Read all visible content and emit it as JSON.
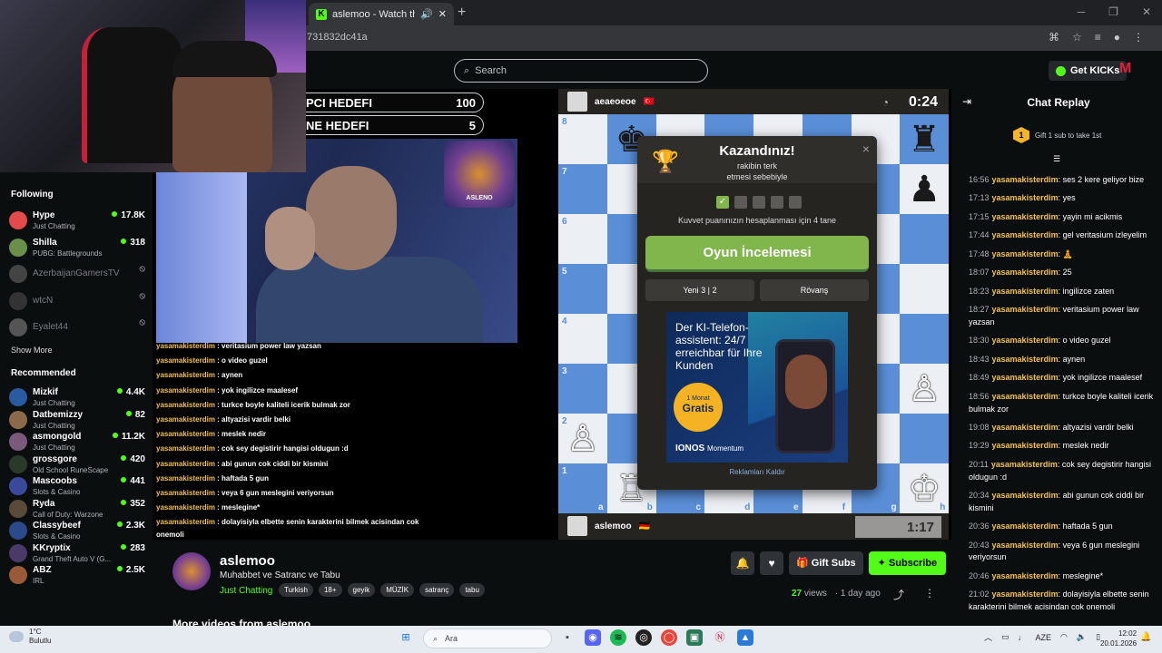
{
  "browser": {
    "tab_title": "aslemoo - Watch the VOD",
    "tab_favicon": "K",
    "new_tab": "+",
    "url_fragment": "731832dc41a"
  },
  "header": {
    "search_placeholder": "Search",
    "get_kicks": "Get KICKs"
  },
  "sidebar": {
    "following_label": "Following",
    "show_more": "Show More",
    "recommended_label": "Recommended",
    "following": [
      {
        "name": "Hype",
        "game": "Just Chatting",
        "viewers": "17.8K",
        "color": "#e34b4b"
      },
      {
        "name": "Shilla",
        "game": "PUBG: Battlegrounds",
        "viewers": "318",
        "color": "#6a8f4a"
      },
      {
        "name": "AzerbaijanGamersTV",
        "game": "",
        "viewers": "",
        "color": "#444"
      },
      {
        "name": "wtcN",
        "game": "",
        "viewers": "",
        "color": "#333"
      },
      {
        "name": "Eyalet44",
        "game": "",
        "viewers": "",
        "color": "#555"
      }
    ],
    "recommended": [
      {
        "name": "Mizkif",
        "game": "Just Chatting",
        "viewers": "4.4K",
        "color": "#2a5aa0"
      },
      {
        "name": "Datbemizzy",
        "game": "Just Chatting",
        "viewers": "82",
        "color": "#8a6a4a"
      },
      {
        "name": "asmongold",
        "game": "Just Chatting",
        "viewers": "11.2K",
        "color": "#7a5a7a"
      },
      {
        "name": "grossgore",
        "game": "Old School RuneScape",
        "viewers": "420",
        "color": "#2a3a2a"
      },
      {
        "name": "Mascoobs",
        "game": "Slots & Casino",
        "viewers": "441",
        "color": "#3a4a9a"
      },
      {
        "name": "Ryda",
        "game": "Call of Duty: Warzone",
        "viewers": "352",
        "color": "#5a4a3a"
      },
      {
        "name": "Classybeef",
        "game": "Slots & Casino",
        "viewers": "2.3K",
        "color": "#2a4a8a"
      },
      {
        "name": "KKryptix",
        "game": "Grand Theft Auto V (G...",
        "viewers": "283",
        "color": "#4a3a6a"
      },
      {
        "name": "ABZ",
        "game": "IRL",
        "viewers": "2.5K",
        "color": "#9a5a3a"
      }
    ]
  },
  "overlay": {
    "goal1_label": "PCI HEDEFI",
    "goal1_value": "100",
    "goal2_label": "NE HEDEFI",
    "goal2_value": "5",
    "logo_text": "ASLENO",
    "chat": [
      {
        "user": "yasamakisterdim",
        "msg": "veritasium power law yazsan"
      },
      {
        "user": "yasamakisterdim",
        "msg": "o video guzel"
      },
      {
        "user": "yasamakisterdim",
        "msg": "aynen"
      },
      {
        "user": "yasamakisterdim",
        "msg": "yok ingilizce maalesef"
      },
      {
        "user": "yasamakisterdim",
        "msg": "turkce boyle kaliteli icerik bulmak zor"
      },
      {
        "user": "yasamakisterdim",
        "msg": "altyazisi vardir belki"
      },
      {
        "user": "yasamakisterdim",
        "msg": "meslek nedir"
      },
      {
        "user": "yasamakisterdim",
        "msg": "cok sey degistirir hangisi oldugun :d"
      },
      {
        "user": "yasamakisterdim",
        "msg": "abi gunun cok ciddi bir kismini"
      },
      {
        "user": "yasamakisterdim",
        "msg": "haftada 5 gun"
      },
      {
        "user": "yasamakisterdim",
        "msg": "veya 6 gun meslegini veriyorsun"
      },
      {
        "user": "yasamakisterdim",
        "msg": "meslegine*"
      },
      {
        "user": "yasamakisterdim",
        "msg": "dolayisiyla elbette senin karakterini bilmek acisindan cok"
      }
    ],
    "chat_wrap": "onemoli"
  },
  "chess": {
    "top_player": "aeaeoeoe",
    "top_clock": "0:24",
    "bottom_player": "aslemoo",
    "bottom_clock": "1:17",
    "ranks": [
      "8",
      "7",
      "6",
      "5",
      "4",
      "3",
      "2",
      "1"
    ],
    "files": [
      "a",
      "b",
      "c",
      "d",
      "e",
      "f",
      "g",
      "h"
    ],
    "light_color": "#eceff4",
    "dark_color": "#5a8fd8",
    "pieces": [
      {
        "sq": "b8",
        "glyph": "♚",
        "side": "b"
      },
      {
        "sq": "h8",
        "glyph": "♜",
        "side": "b"
      },
      {
        "sq": "h7",
        "glyph": "♟",
        "side": "b"
      },
      {
        "sq": "a2",
        "glyph": "♙",
        "side": "w"
      },
      {
        "sq": "h3",
        "glyph": "♙",
        "side": "w"
      },
      {
        "sq": "b1",
        "glyph": "♖",
        "side": "w"
      },
      {
        "sq": "h1",
        "glyph": "♔",
        "side": "w"
      }
    ]
  },
  "modal": {
    "title": "Kazandınız!",
    "sub1": "rakibin terk",
    "sub2": "etmesi sebebiyle",
    "close": "×",
    "checks_on": 1,
    "checks_total": 5,
    "note": "Kuvvet puanınızın hesaplanması için 4 tane",
    "review": "Oyun İncelemesi",
    "new_game": "Yeni 3 | 2",
    "rematch": "Rövanş",
    "ad_text": "Der KI-Telefon-assistent: 24/7 erreichbar für Ihre Kunden",
    "ad_badge_top": "1 Monat",
    "ad_badge_main": "Gratis",
    "ad_brand": "IONOS",
    "ad_brand_sub": "Momentum",
    "remove_ads": "Reklamları Kaldır"
  },
  "video": {
    "channel": "aslemoo",
    "title": "Muhabbet ve Satranc ve Tabu",
    "category": "Just Chatting",
    "tags": [
      "Turkish",
      "18+",
      "geyik",
      "MÜZİK",
      "satranç",
      "tabu"
    ],
    "gift_subs": "Gift Subs",
    "subscribe": "Subscribe",
    "views_count": "27",
    "views_label": "views",
    "age": "1 day ago",
    "more_videos": "More videos from aslemoo"
  },
  "chat": {
    "title": "Chat Replay",
    "gift_text": "Gift 1 sub to take 1st",
    "gift_rank": "1",
    "messages": [
      {
        "time": "16:56",
        "user": "yasamakisterdim",
        "msg": "ses 2 kere geliyor bize"
      },
      {
        "time": "17:13",
        "user": "yasamakisterdim",
        "msg": "yes"
      },
      {
        "time": "17:15",
        "user": "yasamakisterdim",
        "msg": "yayin mi acikmis"
      },
      {
        "time": "17:44",
        "user": "yasamakisterdim",
        "msg": "gel veritasium izleyelim"
      },
      {
        "time": "17:48",
        "user": "yasamakisterdim",
        "msg": "🧘"
      },
      {
        "time": "18:07",
        "user": "yasamakisterdim",
        "msg": "25"
      },
      {
        "time": "18:23",
        "user": "yasamakisterdim",
        "msg": "ingilizce zaten"
      },
      {
        "time": "18:27",
        "user": "yasamakisterdim",
        "msg": "veritasium power law yazsan"
      },
      {
        "time": "18:30",
        "user": "yasamakisterdim",
        "msg": "o video guzel"
      },
      {
        "time": "18:43",
        "user": "yasamakisterdim",
        "msg": "aynen"
      },
      {
        "time": "18:49",
        "user": "yasamakisterdim",
        "msg": "yok ingilizce maalesef"
      },
      {
        "time": "18:56",
        "user": "yasamakisterdim",
        "msg": "turkce boyle kaliteli icerik bulmak zor"
      },
      {
        "time": "19:08",
        "user": "yasamakisterdim",
        "msg": "altyazisi vardir belki"
      },
      {
        "time": "19:29",
        "user": "yasamakisterdim",
        "msg": "meslek nedir"
      },
      {
        "time": "20:11",
        "user": "yasamakisterdim",
        "msg": "cok sey degistirir hangisi oldugun :d"
      },
      {
        "time": "20:34",
        "user": "yasamakisterdim",
        "msg": "abi gunun cok ciddi bir kismini"
      },
      {
        "time": "20:36",
        "user": "yasamakisterdim",
        "msg": "haftada 5 gun"
      },
      {
        "time": "20:43",
        "user": "yasamakisterdim",
        "msg": "veya 6 gun meslegini veriyorsun"
      },
      {
        "time": "20:46",
        "user": "yasamakisterdim",
        "msg": "meslegine*"
      },
      {
        "time": "21:02",
        "user": "yasamakisterdim",
        "msg": "dolayisiyla elbette senin karakterini bilmek acisindan cok onemoli"
      }
    ]
  },
  "taskbar": {
    "temp": "1°C",
    "weather": "Bulutlu",
    "search": "Ara",
    "lang": "AZE",
    "time": "12:02",
    "date": "20.01.2026"
  },
  "colors": {
    "kick_green": "#53fc18",
    "chat_user": "#f4c24a",
    "chess_green": "#81b64c"
  }
}
